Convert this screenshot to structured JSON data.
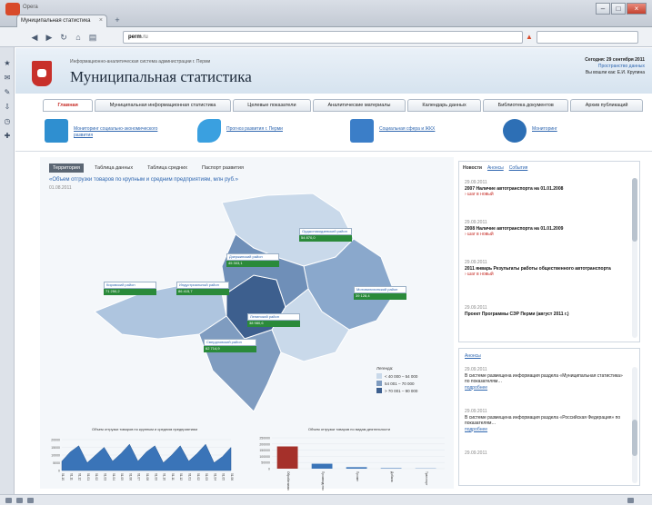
{
  "browser": {
    "app_name": "Opera",
    "tab_title": "Муниципальная статистика",
    "url_domain": "perm",
    "url_text": "ru",
    "search_placeholder": "",
    "status_text": ""
  },
  "header": {
    "org_subtitle": "Информационно-аналитическая система администрации г. Перми",
    "site_title": "Муниципальная статистика",
    "date_line": "Сегодня: 29 сентября 2011",
    "links_line": "Пространство данных",
    "user_line": "Вы вошли как: Е.И. Крупина"
  },
  "menu": {
    "tabs": [
      "Главная",
      "Муниципальная информационная статистика",
      "Целевые показатели",
      "Аналитические материалы",
      "Календарь данных",
      "Библиотека документов",
      "Архив публикаций"
    ]
  },
  "quicklinks": [
    {
      "label": "Мониторинг социально-экономического развития",
      "icon": "books-icon",
      "color": "#2f8fd0"
    },
    {
      "label": "Прогноз развития г. Перми",
      "icon": "trend-arrow-icon",
      "color": "#3aa0e0"
    },
    {
      "label": "Социальная сфера и ЖКХ",
      "icon": "document-icon",
      "color": "#3b7ec8"
    },
    {
      "label": "Мониторинг",
      "icon": "globe-icon",
      "color": "#2d6fb5"
    }
  ],
  "map_panel": {
    "subtabs": [
      "Территория",
      "Таблица данных",
      "Таблица средних",
      "Паспорт развития"
    ],
    "active_subtab": 0,
    "title": "«Объем отгрузки товаров по крупным и средним предприятиям, млн руб.»",
    "date": "01.08.2011",
    "regions": [
      {
        "name": "Орджоникидзевский район",
        "value": "54 870,0"
      },
      {
        "name": "Мотовилихинский район",
        "value": "39 128,4"
      },
      {
        "name": "Кировский район",
        "value": "71 250,2"
      },
      {
        "name": "Индустриальный район",
        "value": "86 415,7"
      },
      {
        "name": "Дзержинский район",
        "value": "45 303,1"
      },
      {
        "name": "Ленинский район",
        "value": "38 980,6"
      },
      {
        "name": "Свердловский район",
        "value": "62 714,9"
      }
    ],
    "legend": {
      "title": "Легенда:",
      "items": [
        {
          "label": "< 40 000 – 54 000",
          "color": "#c9d9ea"
        },
        {
          "label": "54 001 – 70 000",
          "color": "#7f9cc0"
        },
        {
          "label": "> 70 001 – 90 000",
          "color": "#3d5f8e"
        }
      ]
    }
  },
  "chart_data": [
    {
      "type": "area",
      "title": "Объем отгрузки товаров по крупным и средним предприятиям",
      "x": [
        "01.10",
        "01.11",
        "01.12",
        "01.01",
        "01.02",
        "01.03",
        "01.04",
        "01.05",
        "01.06",
        "01.07",
        "01.08",
        "01.09",
        "01.10",
        "01.11",
        "01.12",
        "01.01",
        "01.02",
        "01.03",
        "01.04",
        "01.05",
        "01.06"
      ],
      "values": [
        6000,
        12000,
        16000,
        5000,
        10000,
        15000,
        6000,
        11000,
        17000,
        6000,
        12000,
        16000,
        5000,
        10000,
        16000,
        6000,
        11000,
        17000,
        5000,
        9000,
        15000
      ],
      "ylim": [
        0,
        20000
      ],
      "color": "#3a74b8"
    },
    {
      "type": "bar",
      "title": "Объем отгрузки товаров по видам деятельности",
      "categories": [
        "Обрабатывающие",
        "Производство",
        "Прочие",
        "Добыча",
        "Транспорт"
      ],
      "values": [
        180000,
        40000,
        12000,
        4000,
        2000
      ],
      "colors": [
        "#a5302a",
        "#3a74b8",
        "#3a74b8",
        "#3a74b8",
        "#3a74b8"
      ],
      "ylim": [
        0,
        250000
      ]
    }
  ],
  "news": {
    "tabs": [
      "Новости",
      "Анонсы",
      "События"
    ],
    "items": [
      {
        "date": "29.09.2011",
        "title": "2007 Наличие автотранспорта на 01.01.2008",
        "more": "› шаг в новый"
      },
      {
        "date": "29.09.2011",
        "title": "2008 Наличие автотранспорта на 01.01.2009",
        "more": "› шаг в новый"
      },
      {
        "date": "29.09.2011",
        "title": "2011 январь Результаты работы общественного автотранспорта",
        "more": "› шаг в новый"
      },
      {
        "date": "29.09.2011",
        "title": "Проект Программы СЭР Перми (август 2011 г.)",
        "more": ""
      }
    ]
  },
  "announcements": {
    "tab": "Анонсы",
    "items": [
      {
        "date": "29.09.2011",
        "text": "В системе размещена информация раздела «Муниципальная статистика» по показателям…",
        "link": "подробнее"
      },
      {
        "date": "29.09.2011",
        "text": "В системе размещена информация раздела «Российская Федерация» по показателям…",
        "link": "подробнее"
      },
      {
        "date": "29.09.2011",
        "text": "",
        "link": ""
      }
    ]
  }
}
